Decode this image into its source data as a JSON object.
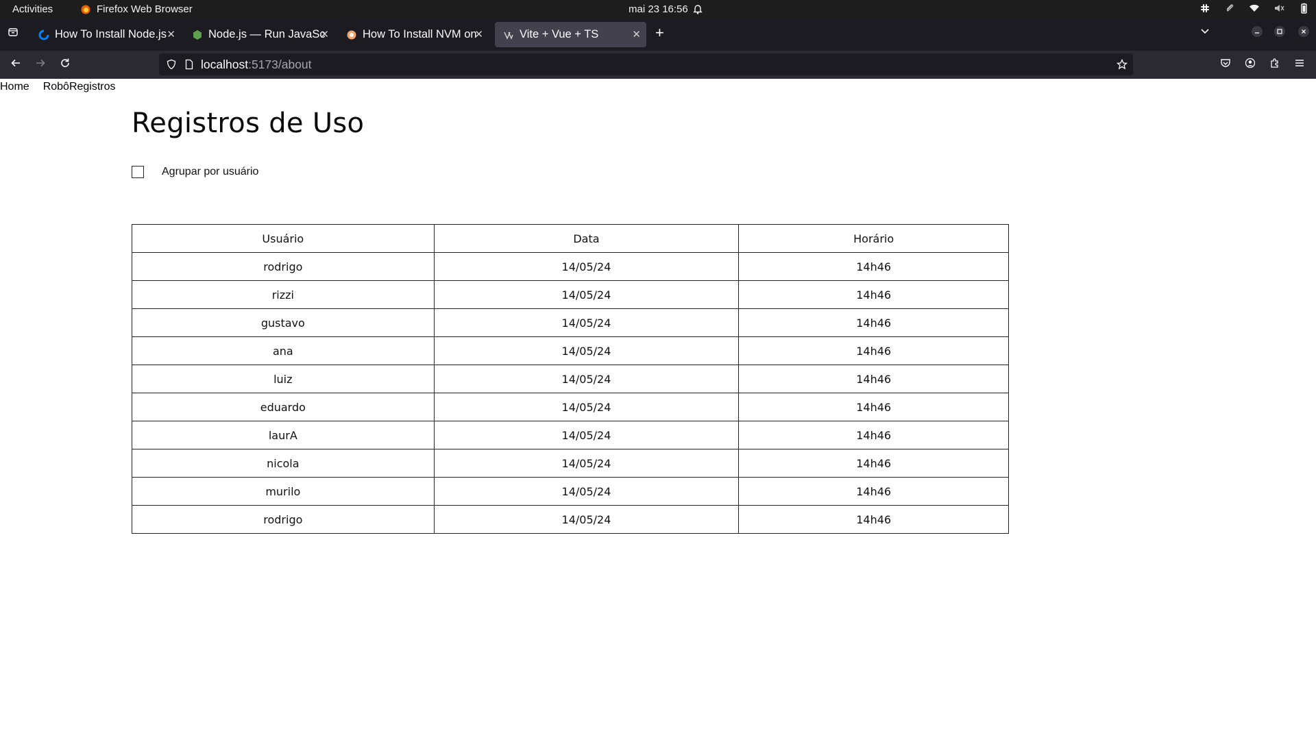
{
  "system_bar": {
    "activities": "Activities",
    "app_name": "Firefox Web Browser",
    "clock": "mai 23  16:56"
  },
  "browser": {
    "tabs": [
      {
        "title": "How To Install Node.js",
        "favicon": "blue-spinner-icon",
        "active": false
      },
      {
        "title": "Node.js — Run JavaScript",
        "favicon": "nodejs-hexagon-icon",
        "active": false
      },
      {
        "title": "How To Install NVM on",
        "favicon": "orange-circle-icon",
        "active": false
      },
      {
        "title": "Vite + Vue + TS",
        "favicon": "vite-icon",
        "active": true
      }
    ],
    "url_host": "localhost",
    "url_path": ":5173/about"
  },
  "page": {
    "nav": [
      {
        "label": "Home"
      },
      {
        "label": "RobôRegistros"
      }
    ],
    "title": "Registros de Uso",
    "group_checkbox_label": "Agrupar por usuário",
    "group_checked": false,
    "table": {
      "headers": [
        "Usuário",
        "Data",
        "Horário"
      ],
      "rows": [
        [
          "rodrigo",
          "14/05/24",
          "14h46"
        ],
        [
          "rizzi",
          "14/05/24",
          "14h46"
        ],
        [
          "gustavo",
          "14/05/24",
          "14h46"
        ],
        [
          "ana",
          "14/05/24",
          "14h46"
        ],
        [
          "luiz",
          "14/05/24",
          "14h46"
        ],
        [
          "eduardo",
          "14/05/24",
          "14h46"
        ],
        [
          "laurA",
          "14/05/24",
          "14h46"
        ],
        [
          "nicola",
          "14/05/24",
          "14h46"
        ],
        [
          "murilo",
          "14/05/24",
          "14h46"
        ],
        [
          "rodrigo",
          "14/05/24",
          "14h46"
        ]
      ]
    }
  },
  "colors": {
    "system_bar_bg": "#1d1d1d",
    "tabstrip_bg": "#1c1b22",
    "active_tab_bg": "#42414d",
    "navbar_bg": "#2b2a33",
    "urlbar_bg": "#1c1b22"
  }
}
